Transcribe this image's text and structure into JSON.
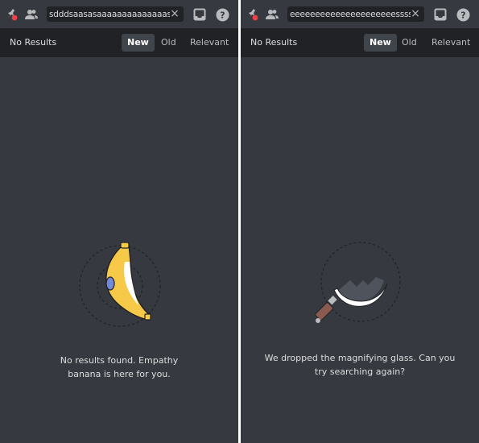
{
  "panels": [
    {
      "search": {
        "value": "sdddsaasasaaaaaaaaaaaaaassddddfff",
        "clear_icon": "×"
      },
      "header": {
        "title": "No Results",
        "sort_options": [
          "New",
          "Old",
          "Relevant"
        ],
        "active_sort": "New"
      },
      "empty_state": {
        "illustration": "empathy-banana",
        "message_line1": "No results found. Empathy",
        "message_line2": "banana is here for you."
      }
    },
    {
      "search": {
        "value": "eeeeeeeeeeeeeeeeeeeeessssssssssssss",
        "clear_icon": "×"
      },
      "header": {
        "title": "No Results",
        "sort_options": [
          "New",
          "Old",
          "Relevant"
        ],
        "active_sort": "New"
      },
      "empty_state": {
        "illustration": "dropped-magnifying-glass",
        "message_line1": "We dropped the magnifying glass. Can you",
        "message_line2": "try searching again?"
      }
    }
  ],
  "icons": {
    "pin": "pin-with-red-dot",
    "members": "member-list",
    "inbox": "inbox",
    "help": "?"
  },
  "colors": {
    "background": "#36393f",
    "header": "#202225",
    "active_tab": "#40444b",
    "text": "#dcddde",
    "muted": "#b9bbbe",
    "notification_dot": "#ed4245"
  }
}
